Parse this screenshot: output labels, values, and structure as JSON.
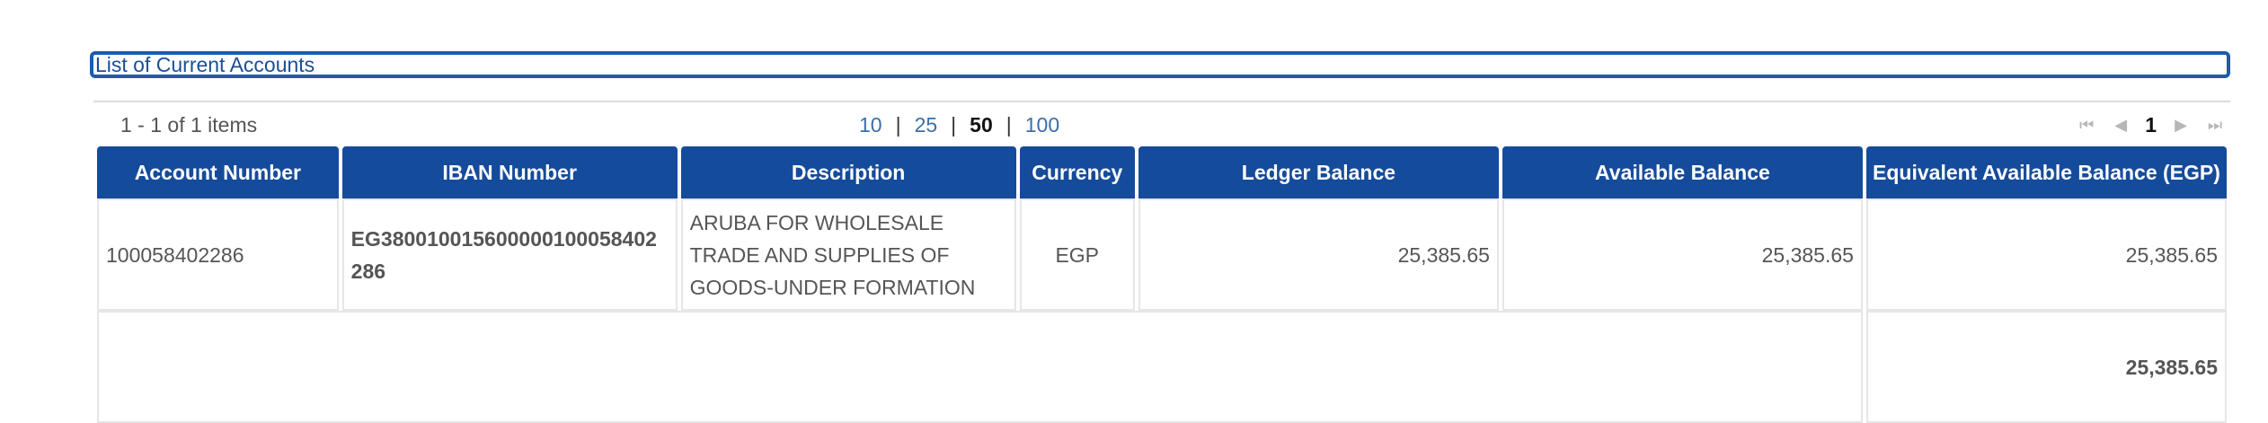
{
  "section": {
    "title": "List of Current Accounts"
  },
  "pager": {
    "summary": "1 - 1 of 1 items",
    "page_sizes": [
      "10",
      "25",
      "50",
      "100"
    ],
    "active_page_size": "50",
    "current_page": "1",
    "icons": [
      "first-page-icon",
      "previous-page-icon",
      "next-page-icon",
      "last-page-icon"
    ]
  },
  "table": {
    "headers": [
      "Account Number",
      "IBAN Number",
      "Description",
      "Currency",
      "Ledger Balance",
      "Available Balance",
      "Equivalent Available Balance (EGP)"
    ],
    "rows": [
      {
        "account_number": "100058402286",
        "iban": "EG380010015600000100058402286",
        "description": "ARUBA FOR WHOLESALE TRADE AND  SUPPLIES OF GOODS-UNDER FORMATION",
        "currency": "EGP",
        "ledger_balance": "25,385.65",
        "available_balance": "25,385.65",
        "equivalent_available_balance": "25,385.65"
      }
    ],
    "total": "25,385.65"
  },
  "colors": {
    "header_bg": "#154b9b",
    "accent": "#1b5cab",
    "link": "#3a6fa8"
  }
}
